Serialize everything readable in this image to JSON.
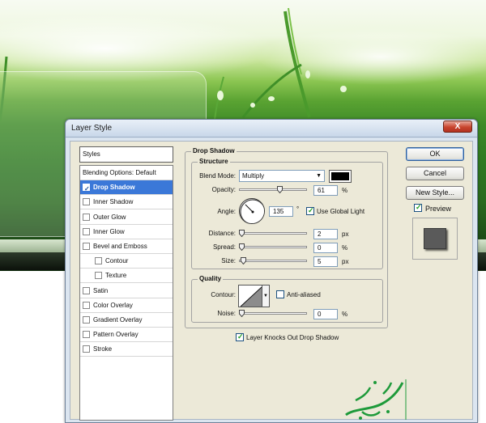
{
  "window": {
    "title": "Layer Style",
    "close_label": "X"
  },
  "styles_panel": {
    "header": "Styles",
    "items": [
      {
        "label": "Blending Options: Default",
        "has_checkbox": false,
        "checked": false,
        "selected": false,
        "indent": 0
      },
      {
        "label": "Drop Shadow",
        "has_checkbox": true,
        "checked": true,
        "selected": true,
        "indent": 0
      },
      {
        "label": "Inner Shadow",
        "has_checkbox": true,
        "checked": false,
        "selected": false,
        "indent": 0
      },
      {
        "label": "Outer Glow",
        "has_checkbox": true,
        "checked": false,
        "selected": false,
        "indent": 0
      },
      {
        "label": "Inner Glow",
        "has_checkbox": true,
        "checked": false,
        "selected": false,
        "indent": 0
      },
      {
        "label": "Bevel and Emboss",
        "has_checkbox": true,
        "checked": false,
        "selected": false,
        "indent": 0
      },
      {
        "label": "Contour",
        "has_checkbox": true,
        "checked": false,
        "selected": false,
        "indent": 1
      },
      {
        "label": "Texture",
        "has_checkbox": true,
        "checked": false,
        "selected": false,
        "indent": 1
      },
      {
        "label": "Satin",
        "has_checkbox": true,
        "checked": false,
        "selected": false,
        "indent": 0
      },
      {
        "label": "Color Overlay",
        "has_checkbox": true,
        "checked": false,
        "selected": false,
        "indent": 0
      },
      {
        "label": "Gradient Overlay",
        "has_checkbox": true,
        "checked": false,
        "selected": false,
        "indent": 0
      },
      {
        "label": "Pattern Overlay",
        "has_checkbox": true,
        "checked": false,
        "selected": false,
        "indent": 0
      },
      {
        "label": "Stroke",
        "has_checkbox": true,
        "checked": false,
        "selected": false,
        "indent": 0
      }
    ]
  },
  "drop_shadow": {
    "section_title": "Drop Shadow",
    "structure": {
      "title": "Structure",
      "blend_mode": {
        "label": "Blend Mode:",
        "value": "Multiply",
        "swatch_color": "#000000"
      },
      "opacity": {
        "label": "Opacity:",
        "value": "61",
        "unit": "%",
        "fraction": 0.61
      },
      "angle": {
        "label": "Angle:",
        "value": "135",
        "unit": "°",
        "degrees": 135
      },
      "use_global_light": {
        "label": "Use Global Light",
        "checked": true
      },
      "distance": {
        "label": "Distance:",
        "value": "2",
        "unit": "px",
        "fraction": 0.0
      },
      "spread": {
        "label": "Spread:",
        "value": "0",
        "unit": "%",
        "fraction": 0.0
      },
      "size": {
        "label": "Size:",
        "value": "5",
        "unit": "px",
        "fraction": 0.02
      }
    },
    "quality": {
      "title": "Quality",
      "contour": {
        "label": "Contour:"
      },
      "anti_aliased": {
        "label": "Anti-aliased",
        "checked": false
      },
      "noise": {
        "label": "Noise:",
        "value": "0",
        "unit": "%",
        "fraction": 0.0
      }
    },
    "layer_knocks_out": {
      "label": "Layer Knocks Out Drop Shadow",
      "checked": true
    }
  },
  "buttons": {
    "ok": "OK",
    "cancel": "Cancel",
    "new_style": "New Style...",
    "preview": {
      "label": "Preview",
      "checked": true
    }
  },
  "colors": {
    "selection": "#3b78d8",
    "logo_green": "#1e9a3a"
  }
}
